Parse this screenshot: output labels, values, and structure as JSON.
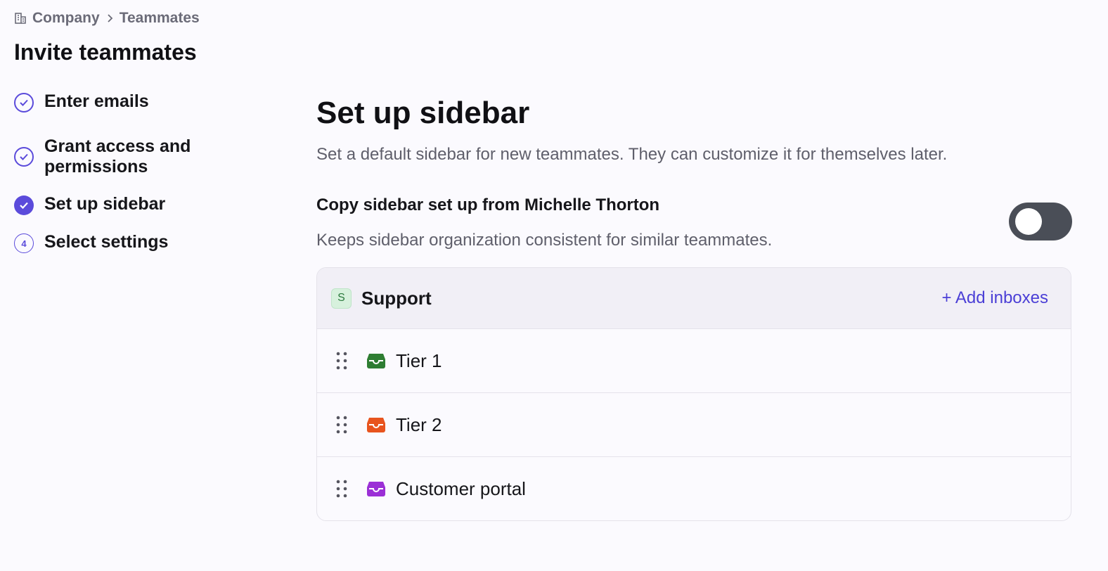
{
  "breadcrumb": {
    "company": "Company",
    "current": "Teammates"
  },
  "page_title": "Invite teammates",
  "steps": [
    {
      "label_line1": "Enter emails",
      "state": "done"
    },
    {
      "label_line1": "Grant access and",
      "label_line2": "permissions",
      "state": "done"
    },
    {
      "label_line1": "Set up sidebar",
      "state": "current"
    },
    {
      "label_line1": "Select settings",
      "state": "todo",
      "number": "4"
    }
  ],
  "main": {
    "title": "Set up sidebar",
    "subtitle": "Set a default sidebar for new teammates. They can customize it for themselves later.",
    "copy": {
      "title": "Copy sidebar set up from Michelle Thorton",
      "description": "Keeps sidebar organization consistent for similar teammates.",
      "toggle_on": false
    },
    "team": {
      "badge": "S",
      "name": "Support",
      "add_label": "+ Add inboxes",
      "inboxes": [
        {
          "label": "Tier 1",
          "color": "#2e7d32"
        },
        {
          "label": "Tier 2",
          "color": "#e8541e"
        },
        {
          "label": "Customer portal",
          "color": "#9b2fd6"
        }
      ]
    }
  },
  "colors": {
    "accent": "#5b4bdb",
    "link": "#4b3fd6",
    "toggle_off": "#4a4e57"
  },
  "icons": [
    "building-icon",
    "chevron-right-icon",
    "check-circle-icon",
    "drag-handle-icon",
    "inbox-icon"
  ]
}
